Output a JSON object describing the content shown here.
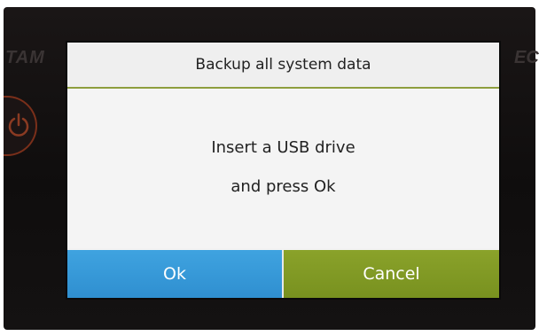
{
  "bezel": {
    "left_text": "TAM",
    "right_text": "EC"
  },
  "dialog": {
    "title": "Backup all system data",
    "message_line_1": "Insert a USB drive",
    "message_line_2": "and press Ok",
    "ok_label": "Ok",
    "cancel_label": "Cancel"
  },
  "colors": {
    "ok_button": "#3a9ddb",
    "cancel_button": "#849c26",
    "title_separator": "#8e9e3e",
    "power_ring": "#7a2f1a"
  },
  "icons": {
    "power": "power-icon"
  }
}
